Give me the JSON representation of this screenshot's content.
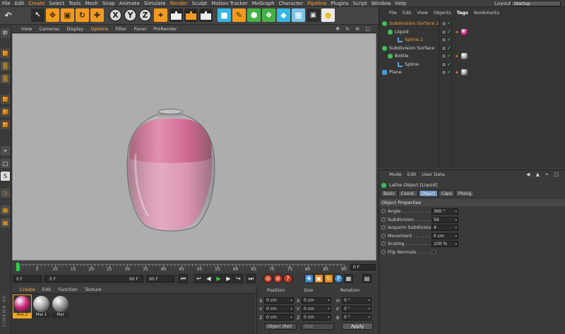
{
  "menubar": {
    "items": [
      "File",
      "Edit",
      "Create",
      "Select",
      "Tools",
      "Mesh",
      "Snap",
      "Animate",
      "Simulate",
      "Render",
      "Sculpt",
      "Motion Tracker",
      "MoGraph",
      "Character",
      "Pipeline",
      "Plugins",
      "Script",
      "Window",
      "Help"
    ],
    "layout_label": "Layout:",
    "layout_value": "Startup"
  },
  "toolbar": {
    "axis_x": "X",
    "axis_y": "Y",
    "axis_z": "Z"
  },
  "viewport": {
    "menu": [
      "View",
      "Cameras",
      "Display",
      "Options",
      "Filter",
      "Panel",
      "ProRender"
    ],
    "icons": "✥ ↻ ⊖ □"
  },
  "timeline": {
    "ticks": [
      "0",
      "5",
      "10",
      "15",
      "20",
      "25",
      "30",
      "35",
      "40",
      "45",
      "50",
      "55",
      "60",
      "65",
      "70",
      "75",
      "80",
      "85",
      "90"
    ],
    "current_frame": "0 F",
    "start_field": "0 F",
    "range_start": "0 F",
    "range_end": "90 F",
    "end_field": "90 F"
  },
  "materials": {
    "menu": [
      "Create",
      "Edit",
      "Function",
      "Texture"
    ],
    "items": [
      {
        "label": "Mat.2",
        "color": "#c92a7a"
      },
      {
        "label": "Mat.1",
        "color": "#a9a9a9"
      },
      {
        "label": "Mat",
        "color": "#9a9a9a"
      }
    ],
    "logo": "CINEMA 4D"
  },
  "coords": {
    "headers": [
      "Position",
      "Size",
      "Rotation"
    ],
    "pos": [
      {
        "axis": "X",
        "value": "0 cm"
      },
      {
        "axis": "Y",
        "value": "0 cm"
      },
      {
        "axis": "Z",
        "value": "0 cm"
      }
    ],
    "size": [
      {
        "axis": "X",
        "value": "0 cm"
      },
      {
        "axis": "Y",
        "value": "0 cm"
      },
      {
        "axis": "Z",
        "value": "0 cm"
      }
    ],
    "rot": [
      {
        "axis": "H",
        "value": "0 °"
      },
      {
        "axis": "P",
        "value": "0 °"
      },
      {
        "axis": "B",
        "value": "0 °"
      }
    ],
    "mode": "Object (Rel)",
    "size_mode": "Size",
    "apply": "Apply"
  },
  "object_manager": {
    "menu": [
      "File",
      "Edit",
      "View",
      "Objects",
      "Tags",
      "Bookmarks"
    ],
    "rows": [
      {
        "name": "Subdivision Surface.1",
        "style": "orange"
      },
      {
        "name": "Liquid",
        "style": "normal"
      },
      {
        "name": "Spline.1",
        "style": "orange"
      },
      {
        "name": "Subdivision Surface",
        "style": "normal"
      },
      {
        "name": "Bottle",
        "style": "normal"
      },
      {
        "name": "Spline",
        "style": "normal"
      },
      {
        "name": "Plane",
        "style": "normal"
      }
    ]
  },
  "attributes": {
    "menu": [
      "Mode",
      "Edit",
      "User Data"
    ],
    "title": "Lathe Object [Liquid]",
    "tabs": [
      "Basic",
      "Coord.",
      "Object",
      "Caps",
      "Phong"
    ],
    "active_tab": "Object",
    "section": "Object Properties",
    "properties": [
      {
        "label": "Angle . . . . . . . . . . . . .",
        "value": "360 °"
      },
      {
        "label": "Subdivision . . . . . . .",
        "value": "56"
      },
      {
        "label": "Isoparm Subdivision",
        "value": "4"
      },
      {
        "label": "Movement . . . . . . . . .",
        "value": "0 cm"
      },
      {
        "label": "Scaling . . . . . . . . . . . .",
        "value": "100 %"
      },
      {
        "label": "Flip Normals . . . . . . .",
        "value": ""
      }
    ]
  },
  "colors": {
    "accent": "#f39a1f",
    "liquid": "#d85088",
    "viewport_bg": "#adadad"
  }
}
